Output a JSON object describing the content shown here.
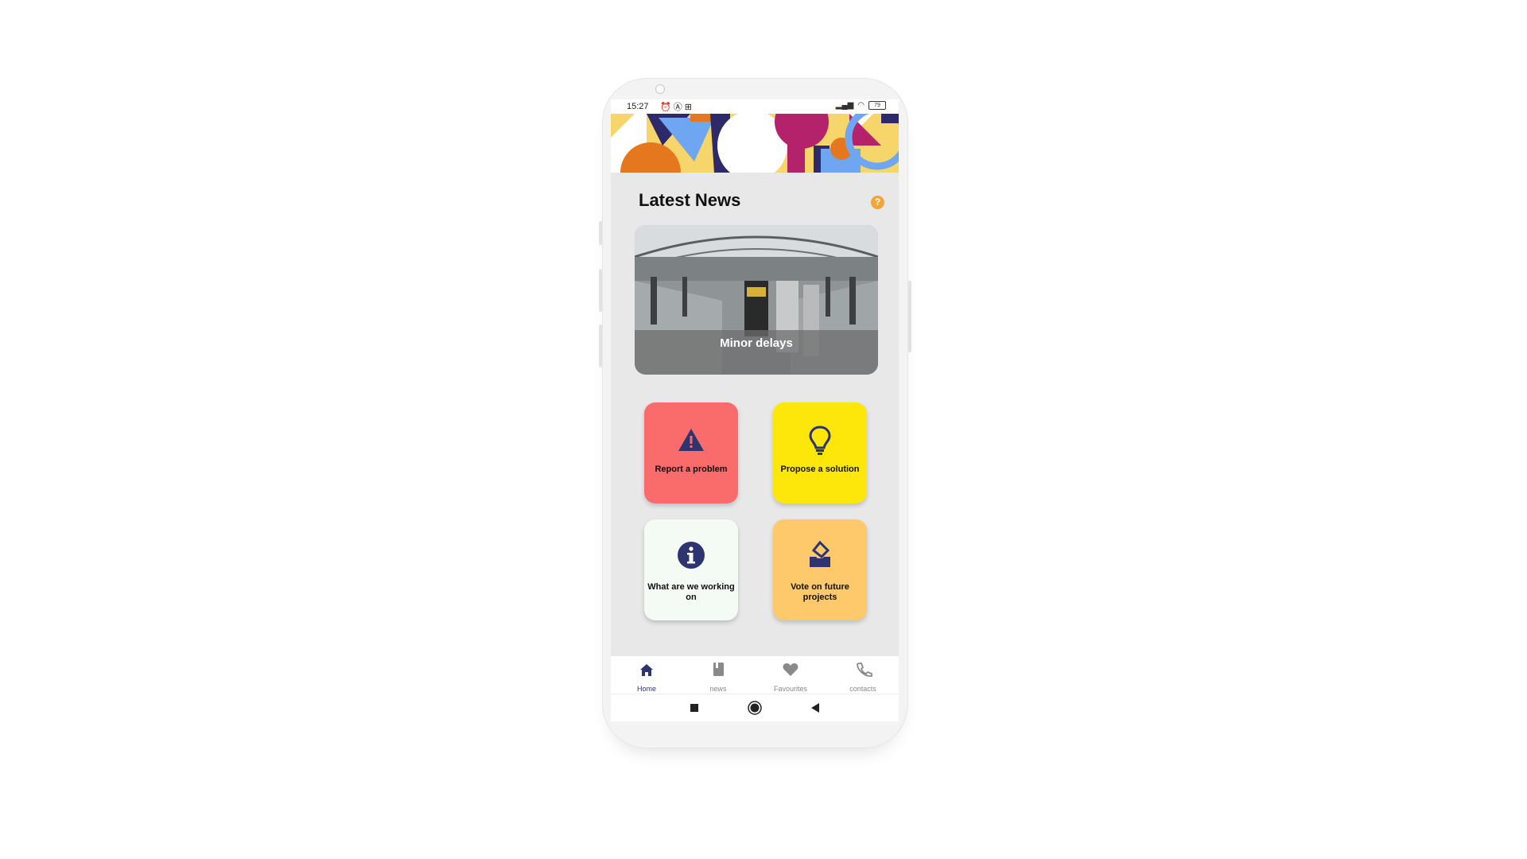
{
  "status_bar": {
    "time": "15:27",
    "battery": "79"
  },
  "header": {
    "title": "Latest News",
    "help_symbol": "?"
  },
  "news": {
    "caption": "Minor delays"
  },
  "actions": [
    {
      "label": "Report a problem",
      "icon": "warning-icon",
      "color": "#fa6b6b"
    },
    {
      "label": "Propose a solution",
      "icon": "lightbulb-icon",
      "color": "#fde70a"
    },
    {
      "label": "What are we working on",
      "icon": "info-icon",
      "color": "#f4fbf4"
    },
    {
      "label": "Vote on future projects",
      "icon": "ballot-box-icon",
      "color": "#fdc96a"
    }
  ],
  "tabs": [
    {
      "label": "Home",
      "icon": "home-icon",
      "active": true
    },
    {
      "label": "news",
      "icon": "book-icon",
      "active": false
    },
    {
      "label": "Favourites",
      "icon": "heart-icon",
      "active": false
    },
    {
      "label": "contacts",
      "icon": "phone-icon",
      "active": false
    }
  ],
  "colors": {
    "accent": "#2e3470",
    "help": "#f0a63a"
  }
}
